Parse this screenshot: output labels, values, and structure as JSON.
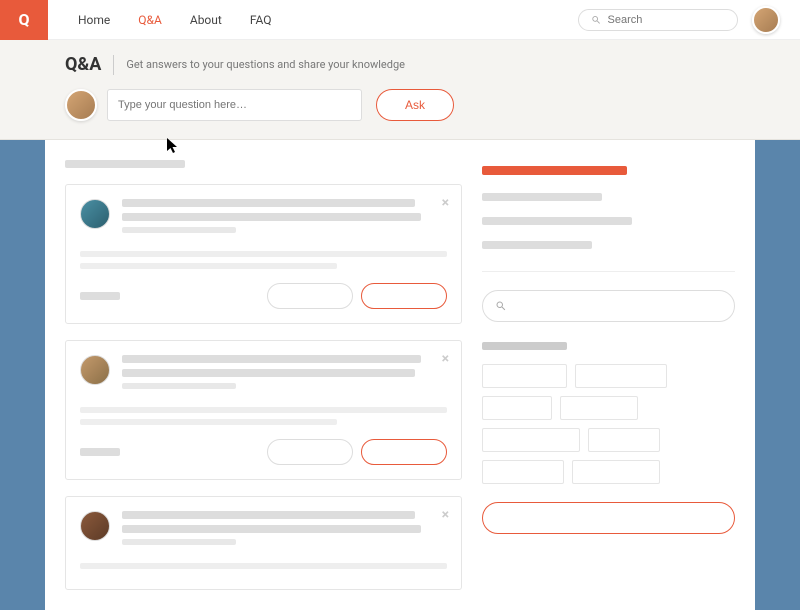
{
  "logo": "Q",
  "nav": {
    "home": "Home",
    "qa": "Q&A",
    "about": "About",
    "faq": "FAQ"
  },
  "search": {
    "placeholder": "Search"
  },
  "hero": {
    "title": "Q&A",
    "subtitle": "Get answers to your questions and share your knowledge",
    "input_placeholder": "Type your question here…",
    "ask_label": "Ask"
  },
  "colors": {
    "accent": "#e85a3b",
    "bg": "#5a85ab"
  }
}
